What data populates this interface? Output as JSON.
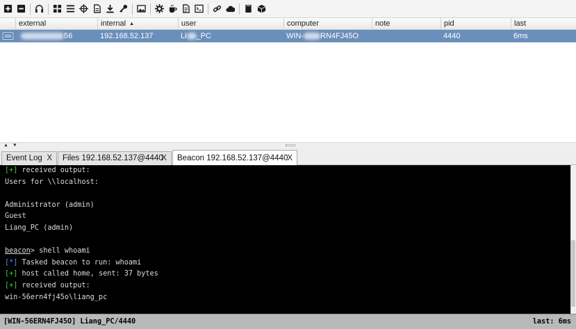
{
  "toolbar": {
    "buttons": [
      {
        "name": "new-connection-icon"
      },
      {
        "name": "disconnect-icon"
      },
      {
        "name": "headset-icon"
      },
      {
        "name": "pivot-graph-icon"
      },
      {
        "name": "session-list-icon"
      },
      {
        "name": "target-crosshair-icon"
      },
      {
        "name": "web-log-icon"
      },
      {
        "name": "download-icon"
      },
      {
        "name": "key-credentials-icon"
      },
      {
        "name": "screenshot-image-icon"
      },
      {
        "name": "settings-gear-icon"
      },
      {
        "name": "coffee-cup-icon"
      },
      {
        "name": "document-icon"
      },
      {
        "name": "terminal-icon"
      },
      {
        "name": "link-chain-icon"
      },
      {
        "name": "cloud-icon"
      },
      {
        "name": "book-icon"
      },
      {
        "name": "package-box-icon"
      }
    ]
  },
  "table": {
    "columns": {
      "external": "external",
      "internal": "internal",
      "user": "user",
      "computer": "computer",
      "note": "note",
      "pid": "pid",
      "last": "last"
    },
    "sort_indicator": "▲",
    "rows": [
      {
        "external_visible": "56",
        "internal": "192.168.52.137",
        "user_prefix": "Li",
        "user_suffix": "_PC",
        "computer_prefix": "WIN-",
        "computer_suffix": "RN4FJ45O",
        "note": "",
        "pid": "4440",
        "last": "6ms"
      }
    ]
  },
  "tabs": [
    {
      "label": "Event Log",
      "close": "X",
      "active": false
    },
    {
      "label": "Files 192.168.52.137@4440",
      "close": "X",
      "active": false
    },
    {
      "label": "Beacon 192.168.52.137@4440",
      "close": "X",
      "active": true
    }
  ],
  "console": {
    "lines": [
      {
        "tag": "[+]",
        "text": " received output:"
      },
      {
        "text": "Users for \\\\localhost:"
      },
      {
        "text": ""
      },
      {
        "text": "Administrator (admin)"
      },
      {
        "text": "Guest"
      },
      {
        "text": "Liang_PC (admin)"
      },
      {
        "text": ""
      },
      {
        "prompt": "beacon",
        "text": "> shell whoami"
      },
      {
        "tag_blue": "[*]",
        "text": " Tasked beacon to run: whoami"
      },
      {
        "tag": "[+]",
        "text": " host called home, sent: 37 bytes"
      },
      {
        "tag": "[+]",
        "text": " received output:"
      },
      {
        "text": "win-56ern4fj45o\\liang_pc"
      }
    ]
  },
  "statusbar": {
    "left": "[WIN-56ERN4FJ45O] Liang_PC/4440",
    "right": "last: 6ms"
  }
}
